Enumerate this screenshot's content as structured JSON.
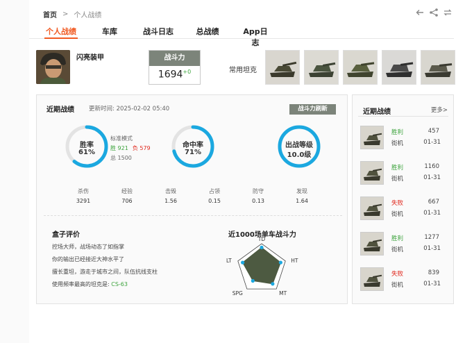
{
  "breadcrumb": {
    "home": "首页",
    "sep": ">",
    "current": "个人战绩"
  },
  "tabs": [
    {
      "label": "个人战绩",
      "active": true
    },
    {
      "label": "车库"
    },
    {
      "label": "战斗日志"
    },
    {
      "label": "总战绩"
    },
    {
      "label": "App日志"
    }
  ],
  "header_icons": [
    "back-arrow-icon",
    "share-icon",
    "refresh-icon"
  ],
  "profile": {
    "name": "闪亮装甲",
    "power_label": "战斗力",
    "power_value": "1694",
    "power_delta": "+0",
    "common_tanks_label": "常用坦克",
    "common_tanks": [
      "tank-1",
      "tank-2",
      "tank-3",
      "tank-4",
      "tank-5"
    ]
  },
  "recent": {
    "title": "近期战绩",
    "update_time": "更新时间: 2025-02-02 05:40",
    "refresh_label": "战斗力刷新",
    "win_rate": {
      "label": "胜率",
      "value": "61%",
      "fraction": 0.61
    },
    "hit_rate": {
      "label": "命中率",
      "value": "71%",
      "fraction": 0.71
    },
    "level": {
      "label": "出战等级",
      "value": "10.0级",
      "fraction": 1.0
    },
    "mode": "标准模式",
    "wins": "胜 921",
    "losses": "负 579",
    "total": "总 1500",
    "stats": [
      {
        "label": "杀伤",
        "value": "3291"
      },
      {
        "label": "经验",
        "value": "706"
      },
      {
        "label": "击毁",
        "value": "1.56"
      },
      {
        "label": "占领",
        "value": "0.15"
      },
      {
        "label": "防守",
        "value": "0.13"
      },
      {
        "label": "发现",
        "value": "1.64"
      }
    ],
    "eval_title": "盒子评价",
    "eval_lines": [
      "控场大师，战场动态了如指掌",
      "你的输出已经接近大神水平了",
      "擅长重坦，游走于城市之间，队伍抗线支柱"
    ],
    "favorite_prefix": "使用频率最高的坦克是: ",
    "favorite_tank": "CS-63",
    "radar_title": "近1000场单车战斗力",
    "radar_axes": [
      "TD",
      "HT",
      "MT",
      "SPG",
      "LT"
    ],
    "radar_values": [
      0.85,
      0.8,
      0.75,
      0.6,
      0.8
    ],
    "ring_color": "#1ba8e0",
    "radar_fill": "#4d5a41"
  },
  "battles_panel": {
    "title": "近期战绩",
    "more": "更多>",
    "items": [
      {
        "result": "胜利",
        "win": true,
        "mode": "街机",
        "damage": "457",
        "date": "01-31"
      },
      {
        "result": "胜利",
        "win": true,
        "mode": "街机",
        "damage": "1160",
        "date": "01-31"
      },
      {
        "result": "失败",
        "win": false,
        "mode": "街机",
        "damage": "667",
        "date": "01-31"
      },
      {
        "result": "胜利",
        "win": true,
        "mode": "街机",
        "damage": "1277",
        "date": "01-31"
      },
      {
        "result": "失败",
        "win": false,
        "mode": "街机",
        "damage": "839",
        "date": "01-31"
      }
    ]
  }
}
